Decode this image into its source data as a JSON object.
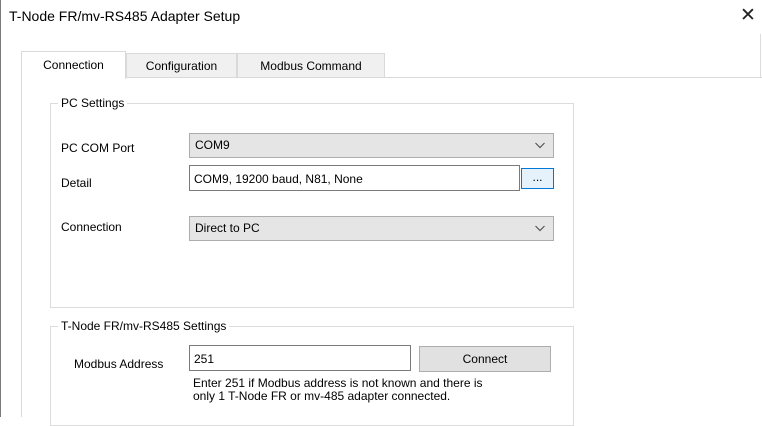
{
  "window": {
    "title": "T-Node FR/mv-RS485 Adapter Setup",
    "close_glyph": "✕"
  },
  "tabs": [
    {
      "label": "Connection",
      "active": true
    },
    {
      "label": "Configuration",
      "active": false
    },
    {
      "label": "Modbus Command",
      "active": false
    }
  ],
  "pc_settings": {
    "legend": "PC Settings",
    "com_port_label": "PC COM Port",
    "com_port_value": "COM9",
    "detail_label": "Detail",
    "detail_value": "COM9, 19200 baud, N81, None",
    "browse_label": "...",
    "connection_label": "Connection",
    "connection_value": "Direct to PC"
  },
  "tnode_settings": {
    "legend": "T-Node FR/mv-RS485 Settings",
    "modbus_address_label": "Modbus Address",
    "modbus_address_value": "251",
    "connect_label": "Connect",
    "help_line1": "Enter 251 if Modbus address is not known and there is",
    "help_line2": "only 1 T-Node FR or mv-485 adapter connected."
  },
  "colors": {
    "accent": "#0078d7",
    "combo_bg": "#e5e5e5",
    "button_bg": "#e1e1e1",
    "border": "#adadad"
  },
  "icons": {
    "close": "close-icon",
    "dropdown": "chevron-down-icon"
  }
}
